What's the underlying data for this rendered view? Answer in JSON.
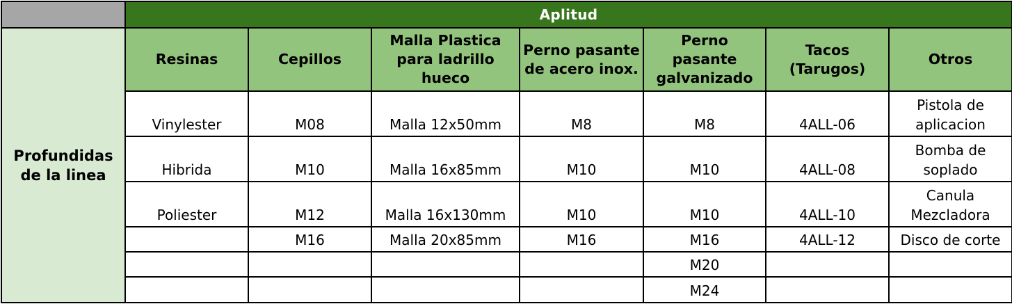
{
  "header": {
    "group_title": "Aplitud",
    "row_title": "Profundidas de la linea"
  },
  "columns": [
    "Resinas",
    "Cepillos",
    "Malla Plastica para ladrillo hueco",
    "Perno pasante de acero inox.",
    "Perno pasante galvanizado",
    "Tacos (Tarugos)",
    "Otros"
  ],
  "rows": [
    [
      "Vinylester",
      "M08",
      "Malla 12x50mm",
      "M8",
      "M8",
      "4ALL-06",
      "Pistola de aplicacion"
    ],
    [
      "Hibrida",
      "M10",
      "Malla 16x85mm",
      "M10",
      "M10",
      "4ALL-08",
      "Bomba de soplado"
    ],
    [
      "Poliester",
      "M12",
      "Malla 16x130mm",
      "M10",
      "M10",
      "4ALL-10",
      "Canula Mezcladora"
    ],
    [
      "",
      "M16",
      "Malla 20x85mm",
      "M16",
      "M16",
      "4ALL-12",
      "Disco de corte"
    ],
    [
      "",
      "",
      "",
      "",
      "M20",
      "",
      ""
    ],
    [
      "",
      "",
      "",
      "",
      "M24",
      "",
      ""
    ]
  ],
  "colors": {
    "banner": "#38761d",
    "column_header": "#93c47d",
    "row_header": "#d9ead3",
    "corner": "#a6a6a6"
  }
}
